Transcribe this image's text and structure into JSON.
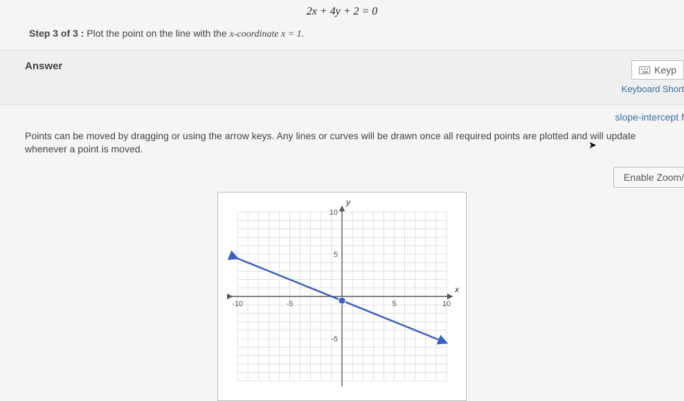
{
  "equation": "2x + 4y + 2 = 0",
  "step": {
    "prefix": "Step 3 of 3 :",
    "text": "Plot the point on the line with the ",
    "var_expr": "x-coordinate x = 1."
  },
  "answer_label": "Answer",
  "keypad_label": "Keyp",
  "keyboard_shortcut_label": "Keyboard Short",
  "slope_intercept_label": "slope-intercept f",
  "instruction": "Points can be moved by dragging or using the arrow keys. Any lines or curves will be drawn once all required points are plotted and will update whenever a point is moved.",
  "zoom_label": "Enable Zoom/Pan",
  "chart_data": {
    "type": "line",
    "title": "",
    "xlabel": "x",
    "ylabel": "y",
    "xlim": [
      -10,
      10
    ],
    "ylim": [
      -10,
      10
    ],
    "xticks": [
      -10,
      -5,
      5,
      10
    ],
    "yticks": [
      -5,
      5,
      10
    ],
    "grid": true,
    "series": [
      {
        "name": "line",
        "x": [
          -10,
          10
        ],
        "y": [
          4.5,
          -5.5
        ],
        "color": "#3b5fc4"
      }
    ],
    "points": [
      {
        "x": 0,
        "y": -0.5,
        "color": "#3b5fc4"
      }
    ]
  }
}
